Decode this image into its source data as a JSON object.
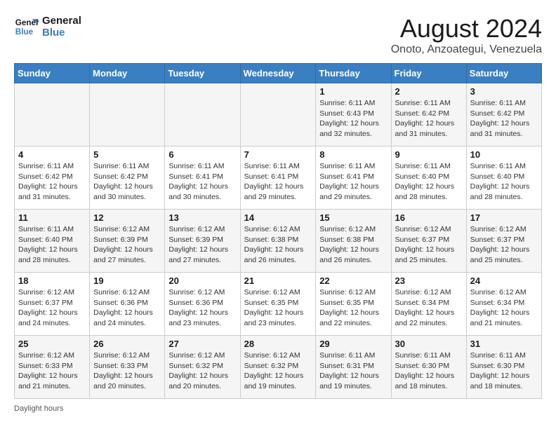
{
  "logo": {
    "line1": "General",
    "line2": "Blue"
  },
  "title": "August 2024",
  "location": "Onoto, Anzoategui, Venezuela",
  "days_of_week": [
    "Sunday",
    "Monday",
    "Tuesday",
    "Wednesday",
    "Thursday",
    "Friday",
    "Saturday"
  ],
  "footer": "Daylight hours",
  "weeks": [
    [
      {
        "day": "",
        "detail": ""
      },
      {
        "day": "",
        "detail": ""
      },
      {
        "day": "",
        "detail": ""
      },
      {
        "day": "",
        "detail": ""
      },
      {
        "day": "1",
        "detail": "Sunrise: 6:11 AM\nSunset: 6:43 PM\nDaylight: 12 hours\nand 32 minutes."
      },
      {
        "day": "2",
        "detail": "Sunrise: 6:11 AM\nSunset: 6:42 PM\nDaylight: 12 hours\nand 31 minutes."
      },
      {
        "day": "3",
        "detail": "Sunrise: 6:11 AM\nSunset: 6:42 PM\nDaylight: 12 hours\nand 31 minutes."
      }
    ],
    [
      {
        "day": "4",
        "detail": "Sunrise: 6:11 AM\nSunset: 6:42 PM\nDaylight: 12 hours\nand 31 minutes."
      },
      {
        "day": "5",
        "detail": "Sunrise: 6:11 AM\nSunset: 6:42 PM\nDaylight: 12 hours\nand 30 minutes."
      },
      {
        "day": "6",
        "detail": "Sunrise: 6:11 AM\nSunset: 6:41 PM\nDaylight: 12 hours\nand 30 minutes."
      },
      {
        "day": "7",
        "detail": "Sunrise: 6:11 AM\nSunset: 6:41 PM\nDaylight: 12 hours\nand 29 minutes."
      },
      {
        "day": "8",
        "detail": "Sunrise: 6:11 AM\nSunset: 6:41 PM\nDaylight: 12 hours\nand 29 minutes."
      },
      {
        "day": "9",
        "detail": "Sunrise: 6:11 AM\nSunset: 6:40 PM\nDaylight: 12 hours\nand 28 minutes."
      },
      {
        "day": "10",
        "detail": "Sunrise: 6:11 AM\nSunset: 6:40 PM\nDaylight: 12 hours\nand 28 minutes."
      }
    ],
    [
      {
        "day": "11",
        "detail": "Sunrise: 6:11 AM\nSunset: 6:40 PM\nDaylight: 12 hours\nand 28 minutes."
      },
      {
        "day": "12",
        "detail": "Sunrise: 6:12 AM\nSunset: 6:39 PM\nDaylight: 12 hours\nand 27 minutes."
      },
      {
        "day": "13",
        "detail": "Sunrise: 6:12 AM\nSunset: 6:39 PM\nDaylight: 12 hours\nand 27 minutes."
      },
      {
        "day": "14",
        "detail": "Sunrise: 6:12 AM\nSunset: 6:38 PM\nDaylight: 12 hours\nand 26 minutes."
      },
      {
        "day": "15",
        "detail": "Sunrise: 6:12 AM\nSunset: 6:38 PM\nDaylight: 12 hours\nand 26 minutes."
      },
      {
        "day": "16",
        "detail": "Sunrise: 6:12 AM\nSunset: 6:37 PM\nDaylight: 12 hours\nand 25 minutes."
      },
      {
        "day": "17",
        "detail": "Sunrise: 6:12 AM\nSunset: 6:37 PM\nDaylight: 12 hours\nand 25 minutes."
      }
    ],
    [
      {
        "day": "18",
        "detail": "Sunrise: 6:12 AM\nSunset: 6:37 PM\nDaylight: 12 hours\nand 24 minutes."
      },
      {
        "day": "19",
        "detail": "Sunrise: 6:12 AM\nSunset: 6:36 PM\nDaylight: 12 hours\nand 24 minutes."
      },
      {
        "day": "20",
        "detail": "Sunrise: 6:12 AM\nSunset: 6:36 PM\nDaylight: 12 hours\nand 23 minutes."
      },
      {
        "day": "21",
        "detail": "Sunrise: 6:12 AM\nSunset: 6:35 PM\nDaylight: 12 hours\nand 23 minutes."
      },
      {
        "day": "22",
        "detail": "Sunrise: 6:12 AM\nSunset: 6:35 PM\nDaylight: 12 hours\nand 22 minutes."
      },
      {
        "day": "23",
        "detail": "Sunrise: 6:12 AM\nSunset: 6:34 PM\nDaylight: 12 hours\nand 22 minutes."
      },
      {
        "day": "24",
        "detail": "Sunrise: 6:12 AM\nSunset: 6:34 PM\nDaylight: 12 hours\nand 21 minutes."
      }
    ],
    [
      {
        "day": "25",
        "detail": "Sunrise: 6:12 AM\nSunset: 6:33 PM\nDaylight: 12 hours\nand 21 minutes."
      },
      {
        "day": "26",
        "detail": "Sunrise: 6:12 AM\nSunset: 6:33 PM\nDaylight: 12 hours\nand 20 minutes."
      },
      {
        "day": "27",
        "detail": "Sunrise: 6:12 AM\nSunset: 6:32 PM\nDaylight: 12 hours\nand 20 minutes."
      },
      {
        "day": "28",
        "detail": "Sunrise: 6:12 AM\nSunset: 6:32 PM\nDaylight: 12 hours\nand 19 minutes."
      },
      {
        "day": "29",
        "detail": "Sunrise: 6:11 AM\nSunset: 6:31 PM\nDaylight: 12 hours\nand 19 minutes."
      },
      {
        "day": "30",
        "detail": "Sunrise: 6:11 AM\nSunset: 6:30 PM\nDaylight: 12 hours\nand 18 minutes."
      },
      {
        "day": "31",
        "detail": "Sunrise: 6:11 AM\nSunset: 6:30 PM\nDaylight: 12 hours\nand 18 minutes."
      }
    ]
  ]
}
